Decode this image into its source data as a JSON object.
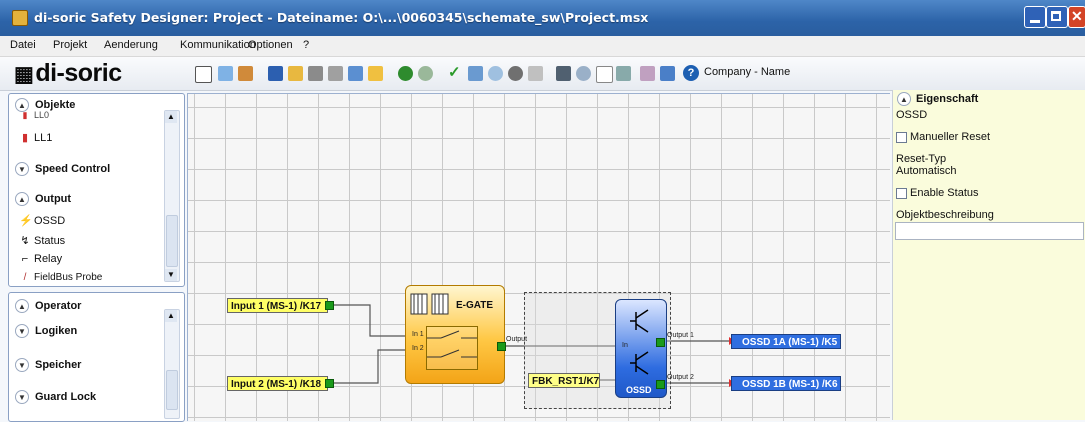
{
  "window": {
    "title": "di-soric Safety Designer: Project  -  Dateiname: O:\\...\\0060345\\schemate_sw\\Project.msx"
  },
  "menu": [
    "Datei",
    "Projekt",
    "Aenderung",
    "Kommunikation",
    "Optionen",
    "?"
  ],
  "toolbar": {
    "logo": "di-soric",
    "company_name": "Company - Name"
  },
  "objects_panel": {
    "header": "Objekte",
    "items_top": [
      "LL0",
      "LL1"
    ],
    "speed_control": "Speed Control",
    "output_header": "Output",
    "output_items": [
      "OSSD",
      "Status",
      "Relay",
      "FieldBus Probe"
    ]
  },
  "operator_panel": {
    "header": "Operator",
    "groups": [
      "Logiken",
      "Speicher",
      "Guard Lock"
    ]
  },
  "schematic": {
    "inputs": [
      "Input 1 (MS-1) /K17",
      "Input 2 (MS-1) /K18"
    ],
    "gate": {
      "title": "E-GATE",
      "in1": "In 1",
      "in2": "In 2",
      "out": "Output"
    },
    "fbk": "FBK_RST1/K7",
    "ossd": {
      "title": "OSSD",
      "in": "In",
      "out1": "Output 1",
      "out2": "Output 2"
    },
    "outputs": [
      "OSSD 1A (MS-1) /K5",
      "OSSD 1B (MS-1) /K6"
    ]
  },
  "properties": {
    "header": "Eigenschaft",
    "object": "OSSD",
    "manual_reset": "Manueller Reset",
    "reset_type_label": "Reset-Typ",
    "reset_type_value": "Automatisch",
    "enable_status": "Enable Status",
    "description_label": "Objektbeschreibung"
  }
}
